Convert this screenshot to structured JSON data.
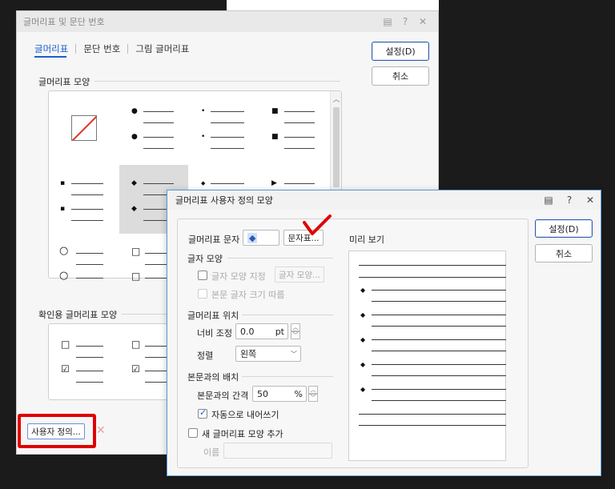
{
  "bg_dialog": {
    "title": "글머리표 및 문단 번호",
    "tabs": [
      "글머리표",
      "문단 번호",
      "그림 글머리표"
    ],
    "ok_label": "설정(D)",
    "cancel_label": "취소",
    "shape_section": "글머리표 모양",
    "check_section": "확인용 글머리표 모양",
    "user_def_label": "사용자 정의...",
    "bullets": [
      "●",
      "•",
      "■",
      "▪",
      "◆",
      "◆",
      "▶",
      "○",
      "□",
      "☑"
    ]
  },
  "fg_dialog": {
    "title": "글머리표 사용자 정의 모양",
    "ok_label": "설정(D)",
    "cancel_label": "취소",
    "bullet_char_label": "글머리표 문자",
    "bullet_char_value": "◆",
    "char_map_btn": "문자표...",
    "font_group": "글자 모양",
    "font_spec_label": "글자 모양 지정",
    "font_btn": "글자 모양...",
    "follow_size_label": "본문 글자 크기 따름",
    "position_group": "글머리표 위치",
    "width_label": "너비 조정",
    "width_value": "0.0",
    "width_unit": "pt",
    "align_label": "정렬",
    "align_value": "왼쪽",
    "layout_group": "본문과의 배치",
    "gap_label": "본문과의 간격",
    "gap_value": "50",
    "gap_unit": "%",
    "auto_indent_label": "자동으로 내어쓰기",
    "add_new_label": "새 글머리표 모양 추가",
    "name_label": "이름",
    "preview_label": "미리 보기"
  },
  "colors": {
    "accent": "#1a5fcc",
    "annotation_red": "#e00000"
  }
}
